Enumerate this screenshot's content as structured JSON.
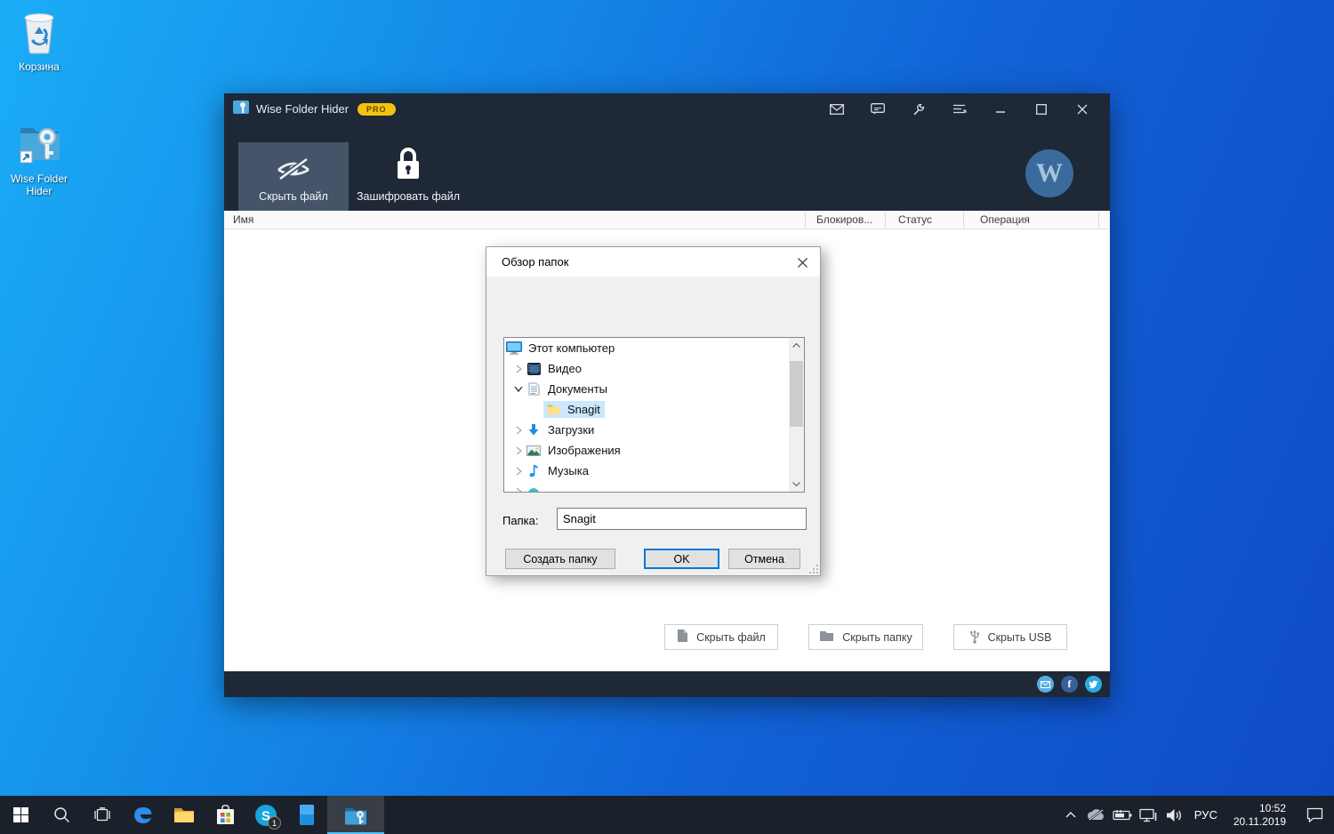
{
  "desktop": {
    "icons": [
      {
        "label": "Корзина"
      },
      {
        "label": "Wise Folder Hider"
      }
    ]
  },
  "window": {
    "title": "Wise Folder Hider",
    "pro_badge": "PRO",
    "toolbar": {
      "hide_file": "Скрыть файл",
      "encrypt_file": "Зашифровать файл"
    },
    "columns": {
      "name": "Имя",
      "lock": "Блокиров...",
      "status": "Статус",
      "operation": "Операция"
    },
    "watermark": "W",
    "actions": {
      "hide_file": "Скрыть файл",
      "hide_folder": "Скрыть папку",
      "hide_usb": "Скрыть USB"
    },
    "social": {
      "facebook": "f"
    }
  },
  "dialog": {
    "title": "Обзор папок",
    "tree": [
      {
        "label": "Этот компьютер"
      },
      {
        "label": "Видео"
      },
      {
        "label": "Документы"
      },
      {
        "label": "Snagit"
      },
      {
        "label": "Загрузки"
      },
      {
        "label": "Изображения"
      },
      {
        "label": "Музыка"
      },
      {
        "label": ""
      }
    ],
    "folder_label": "Папка:",
    "folder_value": "Snagit",
    "buttons": {
      "create": "Создать папку",
      "ok": "OK",
      "cancel": "Отмена"
    }
  },
  "taskbar": {
    "skype_badge": "1",
    "lang": "РУС",
    "time": "10:52",
    "date": "20.11.2019"
  }
}
